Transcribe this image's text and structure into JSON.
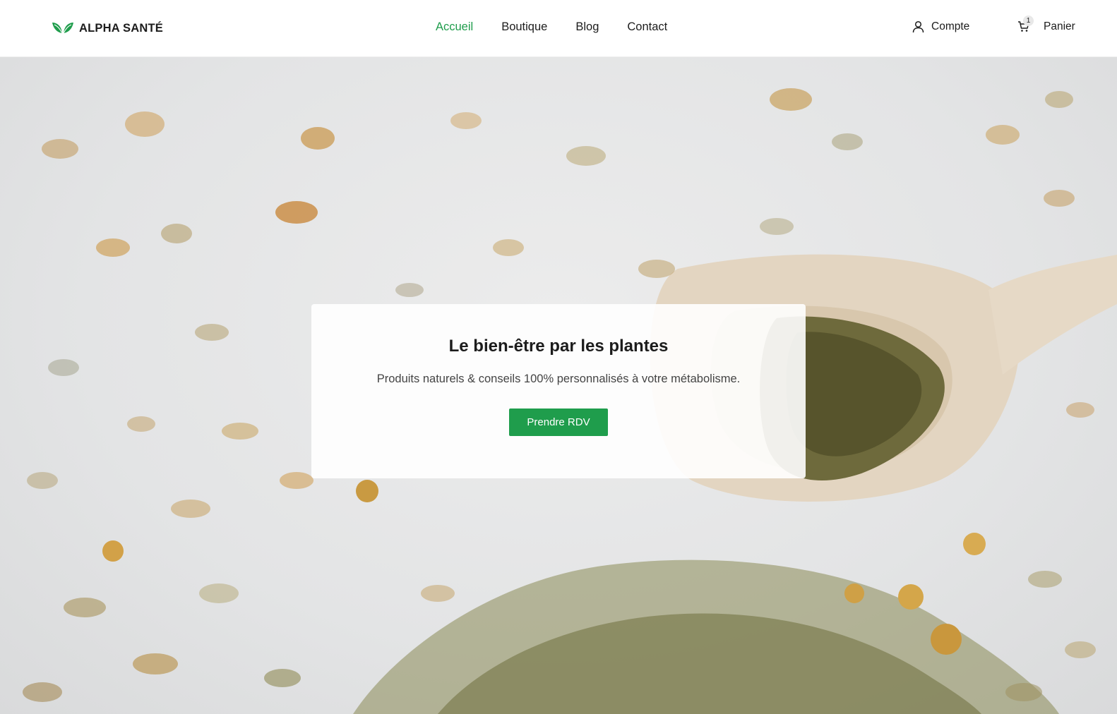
{
  "brand": {
    "name": "ALPHA SANTÉ",
    "logo_icon": "leaf-icon",
    "accent_color": "#1f9d4c"
  },
  "nav": {
    "items": [
      {
        "label": "Accueil",
        "active": true
      },
      {
        "label": "Boutique",
        "active": false
      },
      {
        "label": "Blog",
        "active": false
      },
      {
        "label": "Contact",
        "active": false
      }
    ]
  },
  "account": {
    "label": "Compte",
    "icon": "user-icon"
  },
  "cart": {
    "label": "Panier",
    "icon": "cart-icon",
    "count": "1"
  },
  "hero": {
    "title": "Le bien-être par les plantes",
    "subtitle": "Produits naturels & conseils 100% personnalisés à votre métabolisme.",
    "cta_label": "Prendre RDV"
  }
}
